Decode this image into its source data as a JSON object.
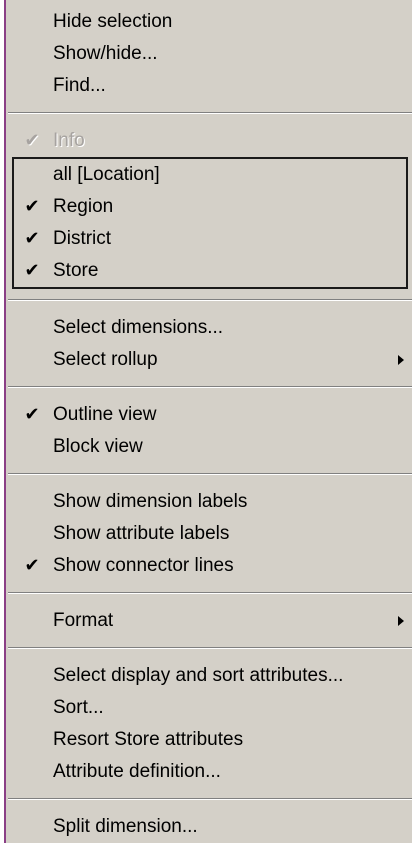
{
  "menu": {
    "sections": [
      {
        "items": [
          {
            "label": "Hide selection",
            "checked": false
          },
          {
            "label": "Show/hide...",
            "checked": false
          },
          {
            "label": "Find...",
            "checked": false
          }
        ]
      },
      {
        "disabled_item": {
          "label": "Info",
          "checked": true
        },
        "levels_box": [
          {
            "label": "all [Location]",
            "checked": false
          },
          {
            "label": "Region",
            "checked": true
          },
          {
            "label": "District",
            "checked": true
          },
          {
            "label": "Store",
            "checked": true
          }
        ]
      },
      {
        "items": [
          {
            "label": "Select dimensions...",
            "checked": false
          },
          {
            "label": "Select rollup",
            "checked": false,
            "submenu": true
          }
        ]
      },
      {
        "items": [
          {
            "label": "Outline view",
            "checked": true
          },
          {
            "label": "Block view",
            "checked": false
          }
        ]
      },
      {
        "items": [
          {
            "label": "Show dimension labels",
            "checked": false
          },
          {
            "label": "Show attribute labels",
            "checked": false
          },
          {
            "label": "Show connector lines",
            "checked": true
          }
        ]
      },
      {
        "items": [
          {
            "label": "Format",
            "checked": false,
            "submenu": true
          }
        ]
      },
      {
        "items": [
          {
            "label": "Select display and sort attributes...",
            "checked": false
          },
          {
            "label": "Sort...",
            "checked": false
          },
          {
            "label": "Resort Store attributes",
            "checked": false
          },
          {
            "label": "Attribute definition...",
            "checked": false
          }
        ]
      },
      {
        "items": [
          {
            "label": "Split dimension...",
            "checked": false
          }
        ]
      }
    ],
    "check_glyph": "✔",
    "colors": {
      "menu_background": "#d4d0c8",
      "text": "#000000",
      "disabled_text": "#a7a3a0",
      "left_accent": "#8a3f86"
    }
  }
}
